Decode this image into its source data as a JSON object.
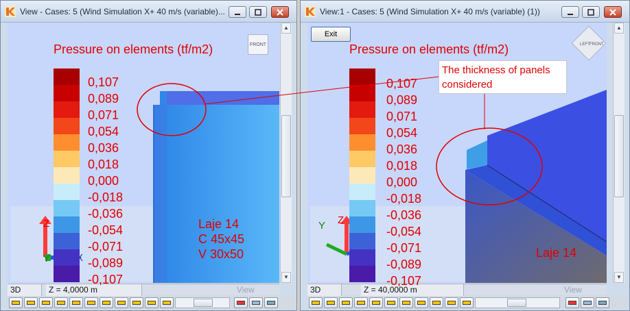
{
  "left_window": {
    "title": "View - Cases: 5 (Wind Simulation X+ 40 m/s (variable)...",
    "status": {
      "mode": "3D",
      "z_level": "Z = 4,0000 m",
      "view_name": "View"
    },
    "view_cube_label": "FRONT",
    "member_labels": [
      "Laje 14",
      "C 45x45",
      "V 30x50"
    ],
    "axes": {
      "z": "Z",
      "y": "Y",
      "x": "X"
    }
  },
  "right_window": {
    "title": "View:1 - Cases: 5 (Wind Simulation X+ 40 m/s (variable) (1))",
    "exit_label": "Exit",
    "status": {
      "mode": "3D",
      "z_level": "Z = 40,0000 m",
      "view_name": "View"
    },
    "view_cube_labels": [
      "LEFT",
      "FRONT"
    ],
    "member_label": "Laje 14",
    "axes": {
      "z": "Z",
      "y": "Y",
      "x": "X"
    }
  },
  "legend": {
    "title": "Pressure on elements (tf/m2)",
    "values": [
      "0,107",
      "0,089",
      "0,071",
      "0,054",
      "0,036",
      "0,018",
      "0,000",
      "-0,018",
      "-0,036",
      "-0,054",
      "-0,071",
      "-0,089",
      "-0,107"
    ],
    "colors": [
      "#a80000",
      "#c70000",
      "#e31a0d",
      "#f2461b",
      "#ff8f2e",
      "#ffca66",
      "#fde8b8",
      "#c9ecfb",
      "#76c9f5",
      "#3e97e6",
      "#3d62d8",
      "#4432c2",
      "#4a1aa8"
    ]
  },
  "annotation": {
    "lines": [
      "The thickness of panels",
      "considered"
    ]
  },
  "theme": {
    "viewport_bg": "#c7d6fb",
    "accent_red": "#e00000",
    "panel_blue": "#3d58e0"
  }
}
